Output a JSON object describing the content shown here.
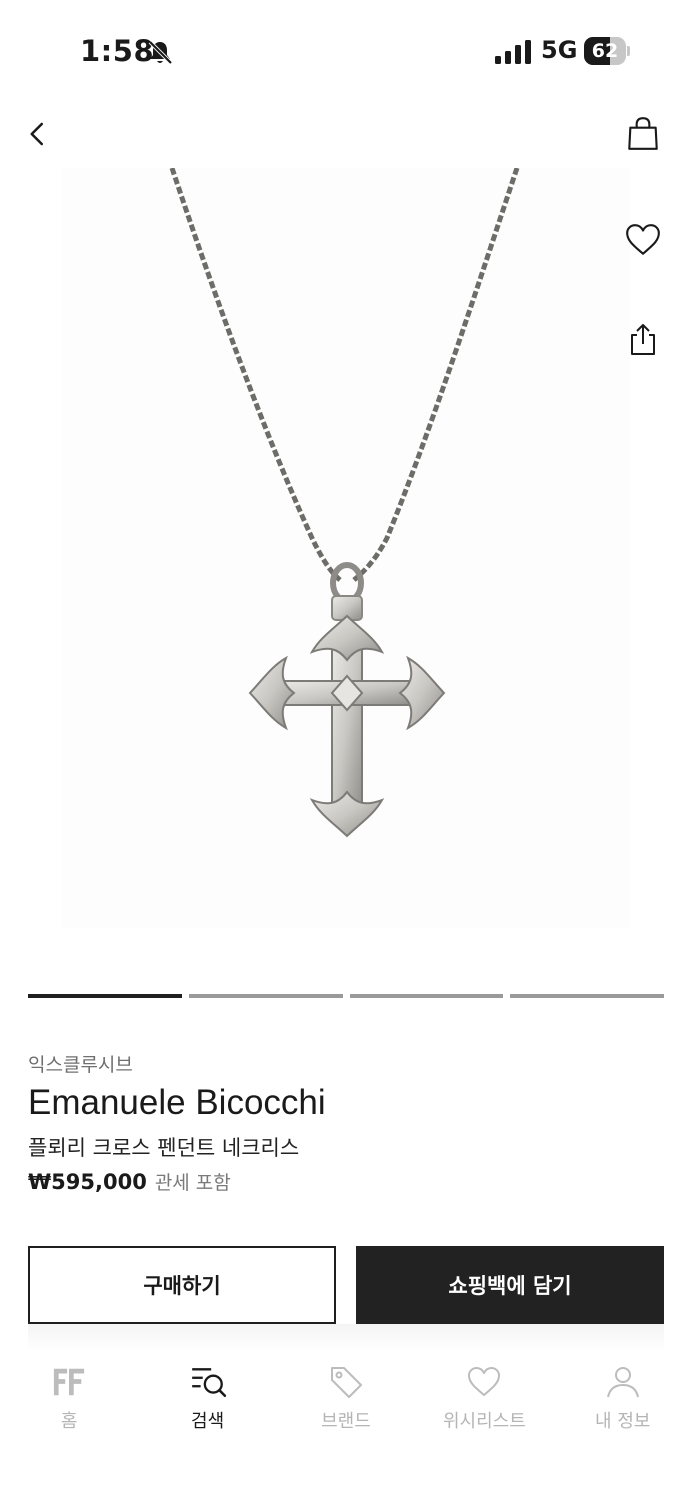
{
  "status_bar": {
    "time": "1:58",
    "network": "5G",
    "battery_level": "62",
    "battery_fraction": 0.62
  },
  "colors": {
    "primary_button_bg": "#222222",
    "active_indicator": "#1f1f1f",
    "inactive_indicator": "#9a9a9a",
    "nav_inactive": "#b5b5b5"
  },
  "carousel": {
    "total_images": 4,
    "current_index": 1
  },
  "product": {
    "category": "익스클루시브",
    "brand": "Emanuele Bicocchi",
    "name": "플뢰리 크로스 펜던트 네크리스",
    "price": "₩595,000",
    "tax_note": "관세 포함"
  },
  "actions": {
    "buy_label": "구매하기",
    "cart_label": "쇼핑백에 담기"
  },
  "nav": {
    "items": [
      {
        "label": "홈",
        "icon": "ff-logo-icon",
        "active": false
      },
      {
        "label": "검색",
        "icon": "search-icon",
        "active": true
      },
      {
        "label": "브랜드",
        "icon": "tag-icon",
        "active": false
      },
      {
        "label": "위시리스트",
        "icon": "heart-icon",
        "active": false
      },
      {
        "label": "내 정보",
        "icon": "person-icon",
        "active": false
      }
    ]
  }
}
